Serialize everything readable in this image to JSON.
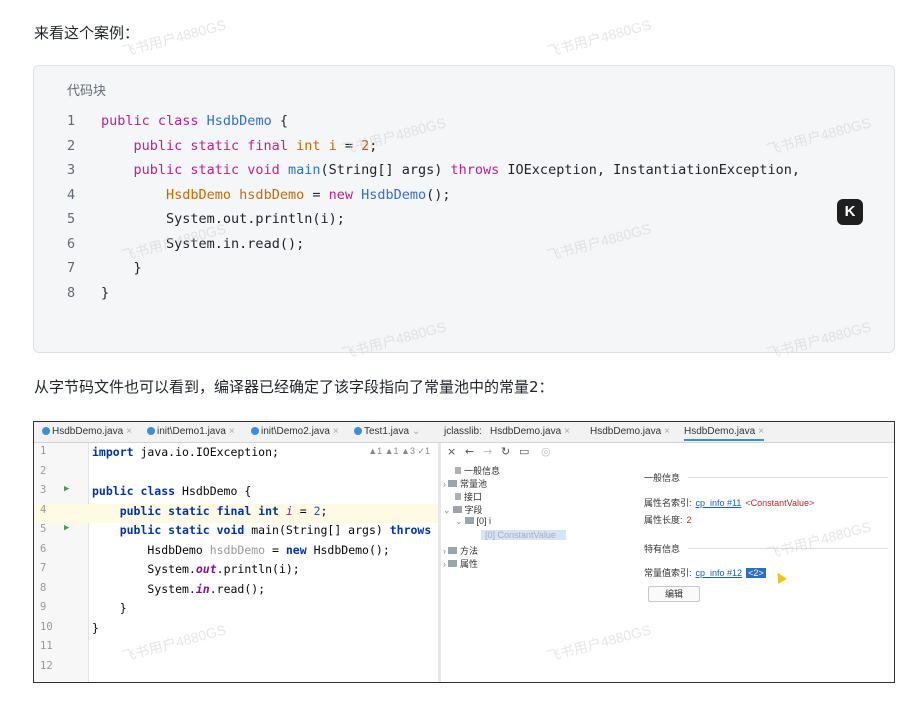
{
  "paragraphs": {
    "intro": "来看这个案例：",
    "conclusion": "从字节码文件也可以看到，编译器已经确定了该字段指向了常量池中的常量2："
  },
  "code_block": {
    "header": "代码块",
    "line_numbers": [
      "1",
      "2",
      "3",
      "4",
      "5",
      "6",
      "7",
      "8"
    ]
  },
  "code_tokens": {
    "l1_kw": "public class ",
    "l1_cls": "HsdbDemo",
    "l1_rest": " {",
    "l2_kw": "public static final ",
    "l2_ty": "int ",
    "l2_var": "i",
    "l2_eq": " = ",
    "l2_num": "2",
    "l2_end": ";",
    "l3_kw": "public static void ",
    "l3_cls": "main",
    "l3_args": "(String[] args) ",
    "l3_kw2": "throws",
    "l3_rest": " IOException, InstantiationException,",
    "l4_ty": "HsdbDemo hsdbDemo",
    "l4_eq": " = ",
    "l4_kw": "new ",
    "l4_cls": "HsdbDemo",
    "l4_end": "();",
    "l5": "System.out.println(i);",
    "l6": "System.in.read();",
    "l7": "}",
    "l8": "}"
  },
  "ide": {
    "left_tabs": [
      "HsdbDemo.java",
      "init\\Demo1.java",
      "init\\Demo2.java",
      "Test1.java"
    ],
    "right_tabs": [
      "jclasslib:",
      "HsdbDemo.java",
      "HsdbDemo.java",
      "HsdbDemo.java"
    ],
    "inspection_summary": "▲1 ▲1 ▲3 ✓1",
    "editor_line_numbers": [
      "1",
      "2",
      "3",
      "4",
      "5",
      "6",
      "7",
      "8",
      "9",
      "10",
      "11",
      "12"
    ],
    "editor": {
      "l1_kw": "import",
      "l1_rest": " java.io.IOException;",
      "l3_kw": "public class",
      "l3_rest": " HsdbDemo {",
      "l4_kw": "public static final int",
      "l4_var": " i",
      "l4_eq": " = ",
      "l4_num": "2",
      "l4_end": ";",
      "l5_kw": "public static void",
      "l5_rest": " main(String[] args) ",
      "l5_kw2": "throws",
      "l6_a": "HsdbDemo ",
      "l6_var": "hsdbDemo",
      "l6_eq": " = ",
      "l6_kw": "new",
      "l6_rest": " HsdbDemo();",
      "l7_a": "System.",
      "l7_static": "out",
      "l7_rest": ".println(i);",
      "l8_a": "System.",
      "l8_static": "in",
      "l8_rest": ".read();",
      "l9": "}",
      "l10": "}"
    },
    "tree": {
      "general": "一般信息",
      "constant_pool": "常量池",
      "interfaces": "接口",
      "fields": "字段",
      "field_i": "[0] i",
      "constant_value": "[0] ConstantValue",
      "methods": "方法",
      "attributes": "属性"
    },
    "details": {
      "general_header": "一般信息",
      "name_index_label": "属性名索引:",
      "name_index_link": "cp_info #11",
      "name_index_value": "<ConstantValue>",
      "length_label": "属性长度:",
      "length_value": "2",
      "specific_header": "特有信息",
      "const_index_label": "常量值索引:",
      "const_index_link": "cp_info #12",
      "const_index_value": "<2>",
      "edit_button": "编辑"
    }
  },
  "watermark": "飞书用户4880GS"
}
